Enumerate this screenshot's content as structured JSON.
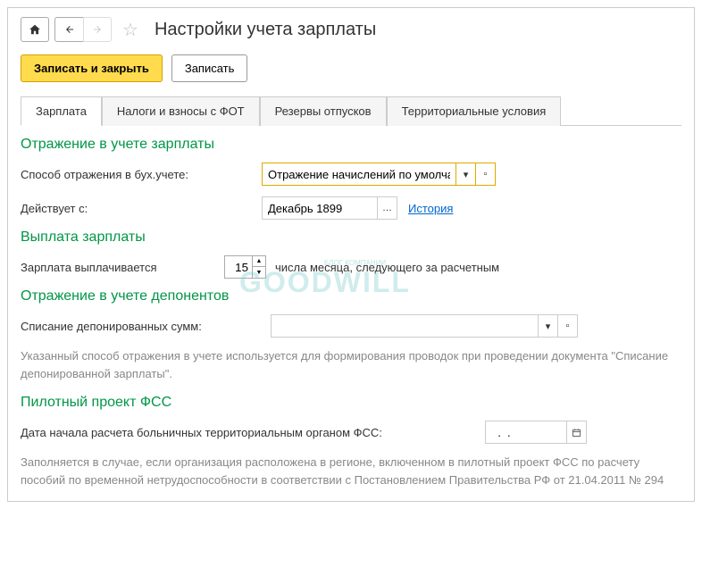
{
  "header": {
    "title": "Настройки учета зарплаты"
  },
  "toolbar": {
    "save_close": "Записать и закрыть",
    "save": "Записать"
  },
  "tabs": [
    {
      "label": "Зарплата",
      "active": true
    },
    {
      "label": "Налоги и взносы с ФОТ",
      "active": false
    },
    {
      "label": "Резервы отпусков",
      "active": false
    },
    {
      "label": "Территориальные условия",
      "active": false
    }
  ],
  "sections": {
    "accounting": {
      "title": "Отражение в учете зарплаты",
      "method_label": "Способ отражения в бух.учете:",
      "method_value": "Отражение начислений по умолчан",
      "effective_label": "Действует с:",
      "effective_value": "Декабрь 1899",
      "history_link": "История"
    },
    "payout": {
      "title": "Выплата зарплаты",
      "paid_label": "Зарплата выплачивается",
      "day_value": "15",
      "suffix": "числа месяца, следующего за расчетным"
    },
    "deponents": {
      "title": "Отражение в учете депонентов",
      "writeoff_label": "Списание депонированных сумм:",
      "writeoff_value": "",
      "hint": "Указанный способ отражения в учете используется для формирования проводок при проведении документа \"Списание депонированной зарплаты\"."
    },
    "fss": {
      "title": "Пилотный проект ФСС",
      "date_label": "Дата начала расчета больничных территориальным органом ФСС:",
      "date_value": "  .  .",
      "hint": "Заполняется в случае, если организация расположена в регионе, включенном в пилотный проект ФСС по расчету пособий по временной нетрудоспособности в соответствии с Постановлением Правительства РФ от 21.04.2011 № 294"
    }
  },
  "watermark": {
    "main": "GOODWILL",
    "sub": "БЛОГ КОМПАНИИ"
  }
}
